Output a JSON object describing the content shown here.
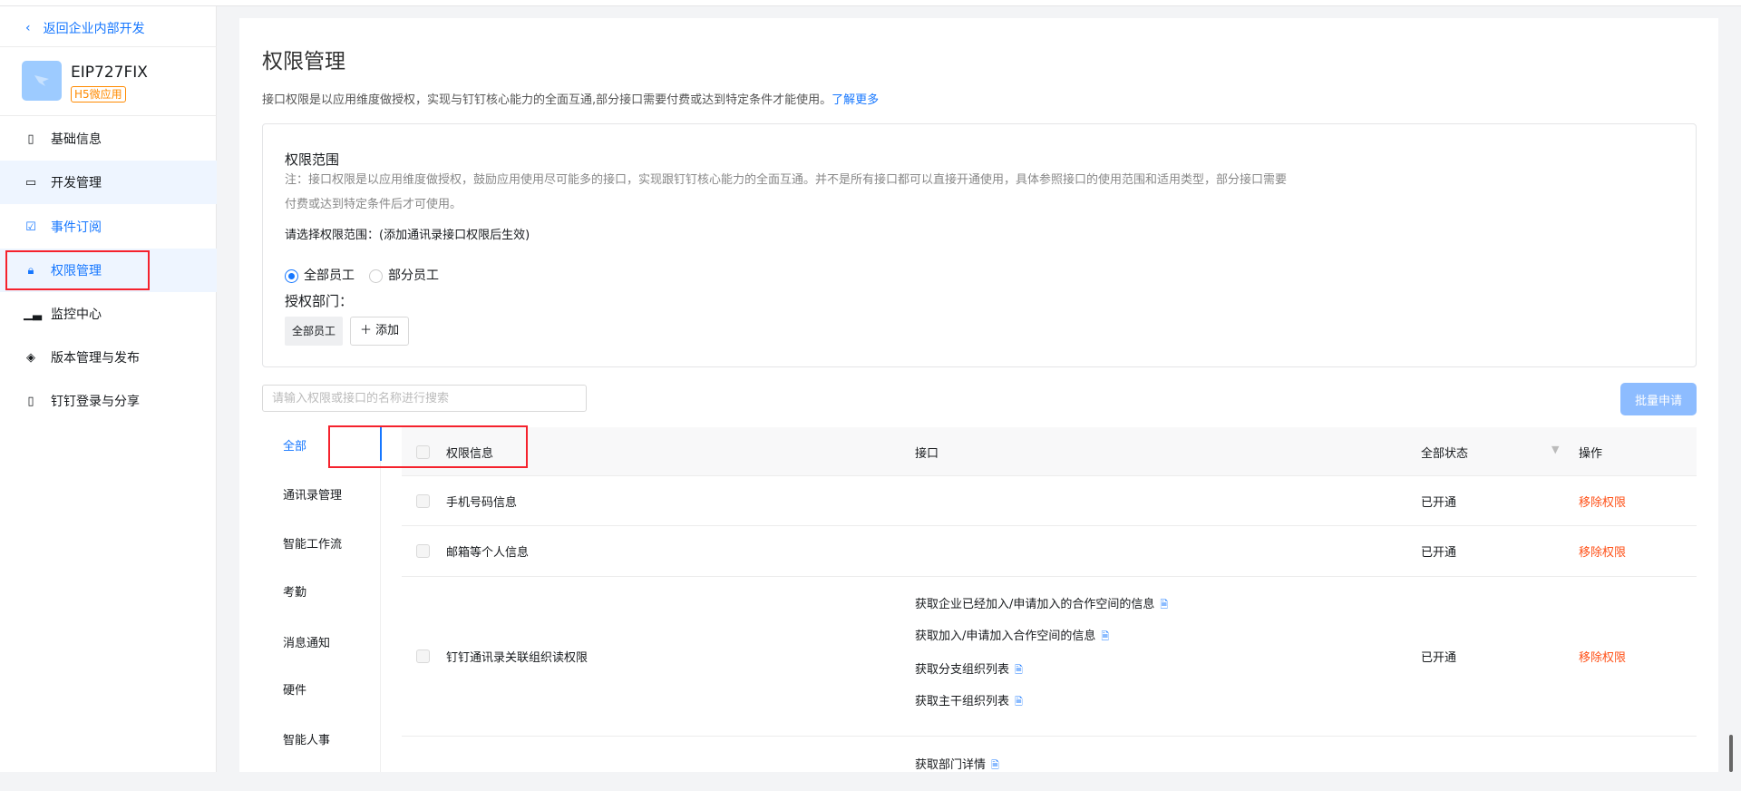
{
  "sidebar": {
    "back_label": "返回企业内部开发",
    "app_name": "EIP727FIX",
    "app_tag": "H5微应用",
    "items": [
      {
        "label": "基础信息",
        "icon": "document-icon"
      },
      {
        "label": "开发管理",
        "icon": "monitor-icon"
      },
      {
        "label": "事件订阅",
        "icon": "subscribe-icon"
      },
      {
        "label": "权限管理",
        "icon": "lock-icon"
      },
      {
        "label": "监控中心",
        "icon": "bar-chart-icon"
      },
      {
        "label": "版本管理与发布",
        "icon": "layers-icon"
      },
      {
        "label": "钉钉登录与分享",
        "icon": "phone-share-icon"
      }
    ]
  },
  "main": {
    "title": "权限管理",
    "description": "接口权限是以应用维度做授权，实现与钉钉核心能力的全面互通,部分接口需要付费或达到特定条件才能使用。",
    "learn_more": "了解更多",
    "scope": {
      "title": "权限范围",
      "note": "注：接口权限是以应用维度做授权，鼓励应用使用尽可能多的接口，实现跟钉钉核心能力的全面互通。并不是所有接口都可以直接开通使用，具体参照接口的使用范围和适用类型，部分接口需要付费或达到特定条件后才可使用。",
      "select_label": "请选择权限范围：(添加通讯录接口权限后生效)",
      "radio_all": "全部员工",
      "radio_partial": "部分员工",
      "dept_label": "授权部门：",
      "dept_tag": "全部员工",
      "add_label": "添加"
    },
    "search_placeholder": "请输入权限或接口的名称进行搜索",
    "batch_label": "批量申请",
    "categories": [
      "全部",
      "通讯录管理",
      "智能工作流",
      "考勤",
      "消息通知",
      "硬件",
      "智能人事"
    ],
    "table": {
      "headers": {
        "info": "权限信息",
        "api": "接口",
        "status": "全部状态",
        "action": "操作"
      },
      "rows": [
        {
          "info": "手机号码信息",
          "apis": [],
          "status": "已开通",
          "action": "移除权限"
        },
        {
          "info": "邮箱等个人信息",
          "apis": [],
          "status": "已开通",
          "action": "移除权限"
        },
        {
          "info": "钉钉通讯录关联组织读权限",
          "apis": [
            "获取企业已经加入/申请加入的合作空间的信息",
            "获取加入/申请加入合作空间的信息",
            "获取分支组织列表",
            "获取主干组织列表"
          ],
          "status": "已开通",
          "action": "移除权限"
        },
        {
          "apis": [
            "获取部门详情"
          ]
        }
      ]
    }
  }
}
